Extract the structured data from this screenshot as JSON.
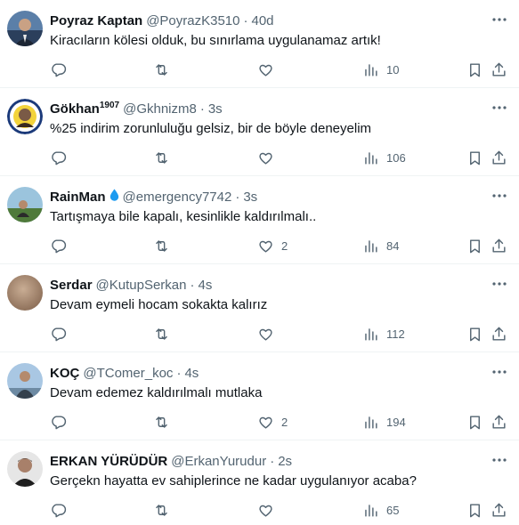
{
  "colors": {
    "text_primary": "#0f1419",
    "text_secondary": "#536471",
    "divider": "#eff3f4",
    "verified_drop": "#1d9bf0"
  },
  "icons": [
    "more-icon",
    "reply-icon",
    "retweet-icon",
    "like-icon",
    "views-icon",
    "bookmark-icon",
    "share-icon",
    "water-drop-icon"
  ],
  "tweets": [
    {
      "name": "Poyraz Kaptan",
      "name_sup": "",
      "handle": "@PoyrazK3510",
      "time": "40d",
      "text": "Kiracıların kölesi olduk, bu sınırlama uygulanamaz artık!",
      "likes": "",
      "views": "10"
    },
    {
      "name": "Gökhan",
      "name_sup": "1907",
      "handle": "@Gkhnizm8",
      "time": "3s",
      "text": "%25 indirim zorunluluğu gelsiz, bir de böyle deneyelim",
      "likes": "",
      "views": "106"
    },
    {
      "name": "RainMan",
      "name_sup": "",
      "handle": "@emergency7742",
      "time": "3s",
      "text": "Tartışmaya bile kapalı, kesinlikle kaldırılmalı..",
      "likes": "2",
      "views": "84"
    },
    {
      "name": "Serdar",
      "name_sup": "",
      "handle": "@KutupSerkan",
      "time": "4s",
      "text": "Devam eymeli hocam sokakta kalırız",
      "likes": "",
      "views": "112"
    },
    {
      "name": "KOÇ",
      "name_sup": "",
      "handle": "@TComer_koc",
      "time": "4s",
      "text": "Devam edemez kaldırılmalı mutlaka",
      "likes": "2",
      "views": "194"
    },
    {
      "name": "ERKAN YÜRÜDÜR",
      "name_sup": "",
      "handle": "@ErkanYurudur",
      "time": "2s",
      "text": "Gerçekn hayatta ev sahiplerince ne kadar uygulanıyor acaba?",
      "likes": "",
      "views": "65"
    }
  ]
}
